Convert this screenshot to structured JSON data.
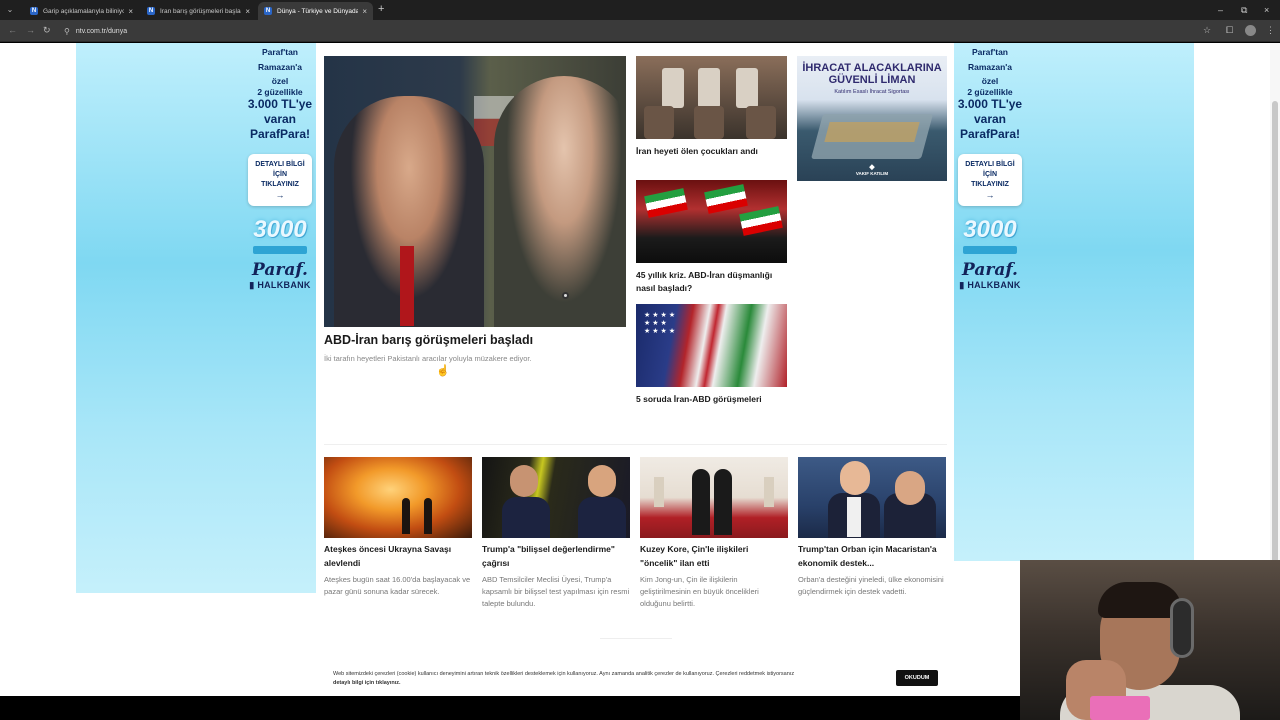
{
  "browser": {
    "tabs": [
      {
        "title": "Garip açıklamalarıyla biliniyor: N",
        "active": false
      },
      {
        "title": "İran barış görüşmeleri başladı ·",
        "active": false
      },
      {
        "title": "Dünya - Türkiye ve Dünyadan D",
        "active": true
      }
    ],
    "url": "ntv.com.tr/dunya",
    "icons": {
      "back": "arrow-left-icon",
      "forward": "arrow-right-icon",
      "reload": "reload-icon",
      "star": "star-icon",
      "extensions": "puzzle-icon",
      "tab_search": "chevron-down-icon",
      "new_tab": "plus-icon"
    }
  },
  "side_ad": {
    "line1": "Paraf'tan",
    "line2": "Ramazan'a",
    "line3": "özel",
    "line4": "2 güzellikle",
    "amount": "3.000 TL'ye",
    "line5": "varan",
    "brand_para": "ParafPara!",
    "button_l1": "DETAYLI BİLGİ",
    "button_l2": "İÇİN",
    "button_l3": "TIKLAYINIZ",
    "graphic_number": "3000",
    "logo": "Paraf.",
    "bank": "HALKBANK"
  },
  "main_story": {
    "title": "ABD-İran barış görüşmeleri başladı",
    "description": "İki tarafın heyetleri Pakistanlı aracılar yoluyla müzakere ediyor."
  },
  "mid_stories": [
    {
      "title": "İran heyeti ölen çocukları andı"
    },
    {
      "title": "45 yıllık kriz. ABD-İran düşmanlığı nasıl başladı?"
    },
    {
      "title": "5 soruda İran-ABD görüşmeleri"
    }
  ],
  "box_ad": {
    "headline_1": "İHRACAT ALACAKLARINA",
    "headline_2": "GÜVENLİ LİMAN",
    "sub": "Katılım Esaslı İhracat Sigortası",
    "logo": "VAKIF KATILIM"
  },
  "cards": [
    {
      "title": "Ateşkes öncesi Ukrayna Savaşı alevlendi",
      "desc": "Ateşkes bugün saat 16.00'da başlayacak ve pazar günü sonuna kadar sürecek."
    },
    {
      "title": "Trump'a \"bilişsel değerlendirme\" çağrısı",
      "desc": "ABD Temsilciler Meclisi Üyesi, Trump'a kapsamlı bir bilişsel test yapılması için resmi talepte bulundu."
    },
    {
      "title": "Kuzey Kore, Çin'le ilişkileri \"öncelik\" ilan etti",
      "desc": "Kim Jong-un, Çin ile ilişkilerin geliştirilmesinin en büyük öncelikleri olduğunu belirtti."
    },
    {
      "title": "Trump'tan Orban için Macaristan'a ekonomik destek...",
      "desc": "Orban'a desteğini yineledi, ülke ekonomisini güçlendirmek için destek vadetti."
    }
  ],
  "cookie": {
    "text": "Web sitemizdeki çerezleri (cookie) kullanıcı deneyimini artıran teknik özellikleri desteklemek için kullanıyoruz. Aynı zamanda analitik çerezler de kullanıyoruz. Çerezleri reddetmek istiyorsanız",
    "link": "detaylı bilgi için tıklayınız.",
    "button": "OKUDUM"
  }
}
